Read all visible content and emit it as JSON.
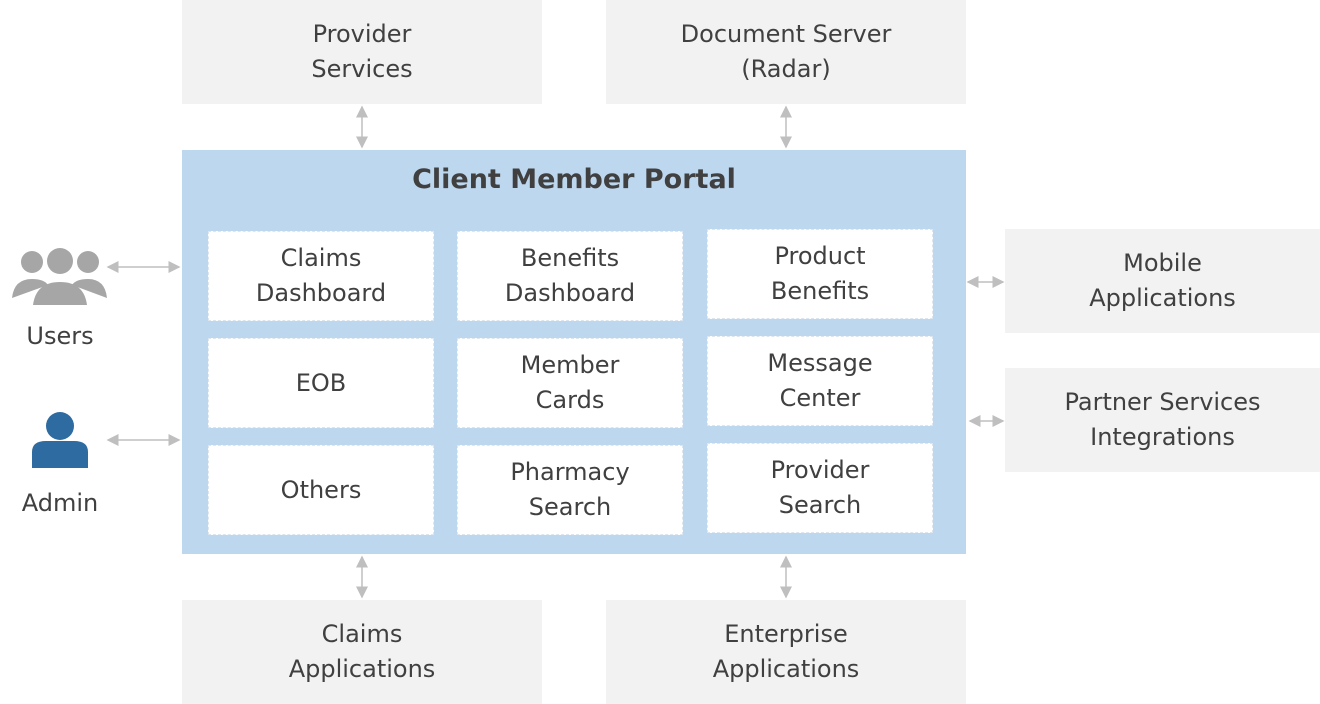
{
  "portal": {
    "title": "Client Member Portal",
    "color": "#BDD7EE",
    "modules": [
      [
        "Claims\nDashboard",
        "Benefits\nDashboard",
        "Product\nBenefits"
      ],
      [
        "EOB",
        "Member\nCards",
        "Message\nCenter"
      ],
      [
        "Others",
        "Pharmacy\nSearch",
        "Provider\nSearch"
      ]
    ]
  },
  "top": [
    "Provider\nServices",
    "Document Server\n(Radar)"
  ],
  "bottom": [
    "Claims\nApplications",
    "Enterprise\nApplications"
  ],
  "right": [
    "Mobile\nApplications",
    "Partner Services\nIntegrations"
  ],
  "actors": [
    {
      "label": "Users",
      "icon": "users-group-icon",
      "color": "#A6A6A6"
    },
    {
      "label": "Admin",
      "icon": "user-icon",
      "color": "#2E6BA0"
    }
  ]
}
